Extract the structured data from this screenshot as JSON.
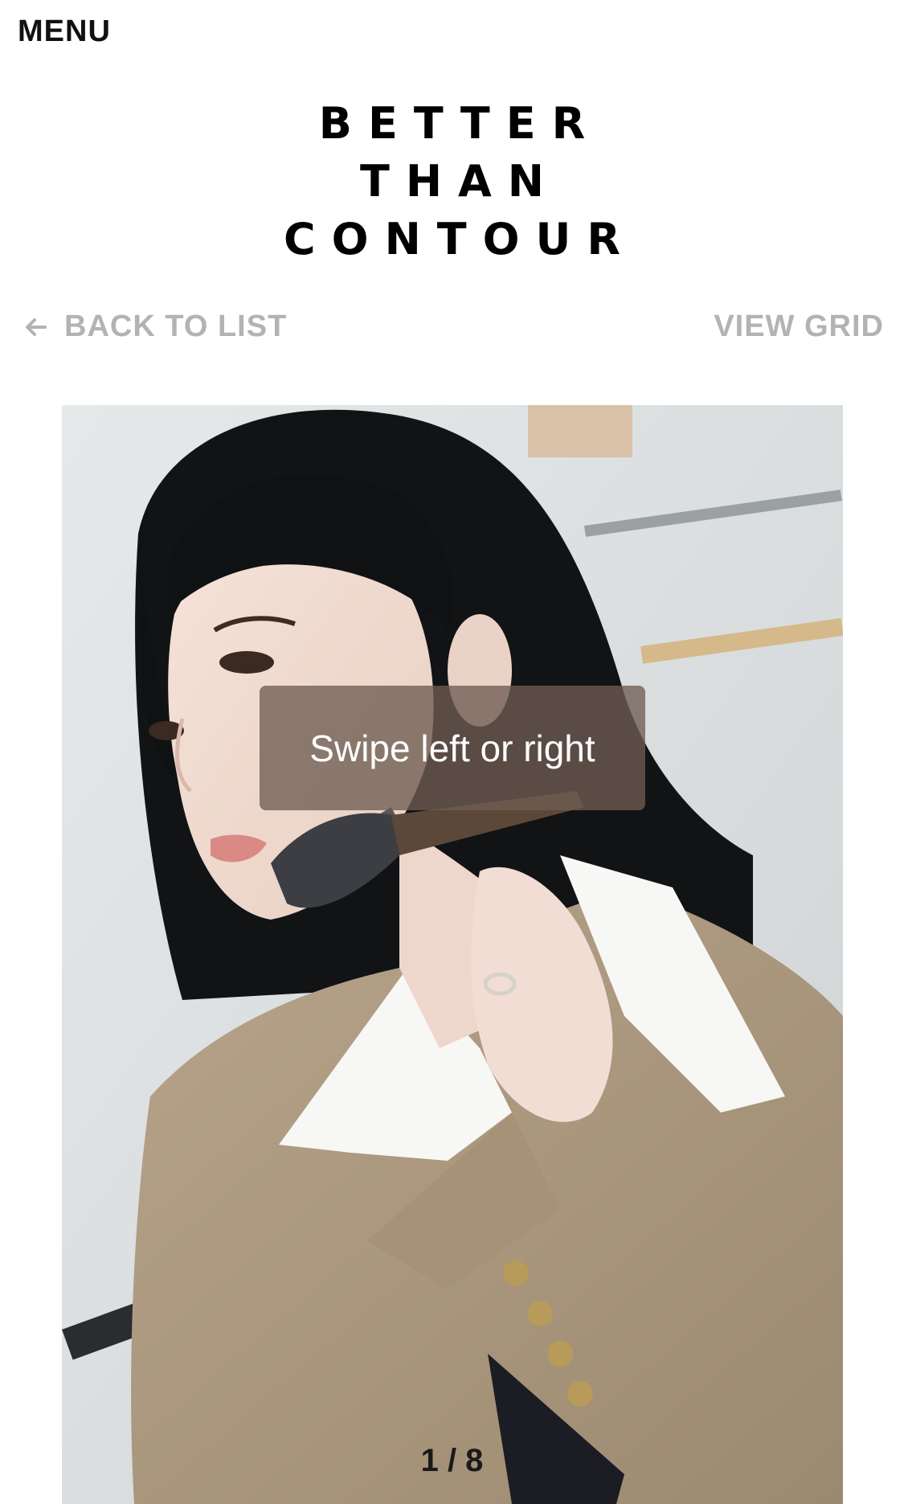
{
  "header": {
    "menu_label": "MENU",
    "logo_lines": [
      "BETTER",
      "THAN",
      "CONTOUR"
    ]
  },
  "nav": {
    "back_label": "BACK TO LIST",
    "view_grid_label": "VIEW GRID",
    "back_icon": "arrow-left-icon"
  },
  "gallery": {
    "swipe_hint": "Swipe left or right",
    "counter": "1 / 8"
  },
  "colors": {
    "nav_text": "#b3b3b3",
    "hint_bg": "#6e5c52",
    "text": "#111111"
  }
}
